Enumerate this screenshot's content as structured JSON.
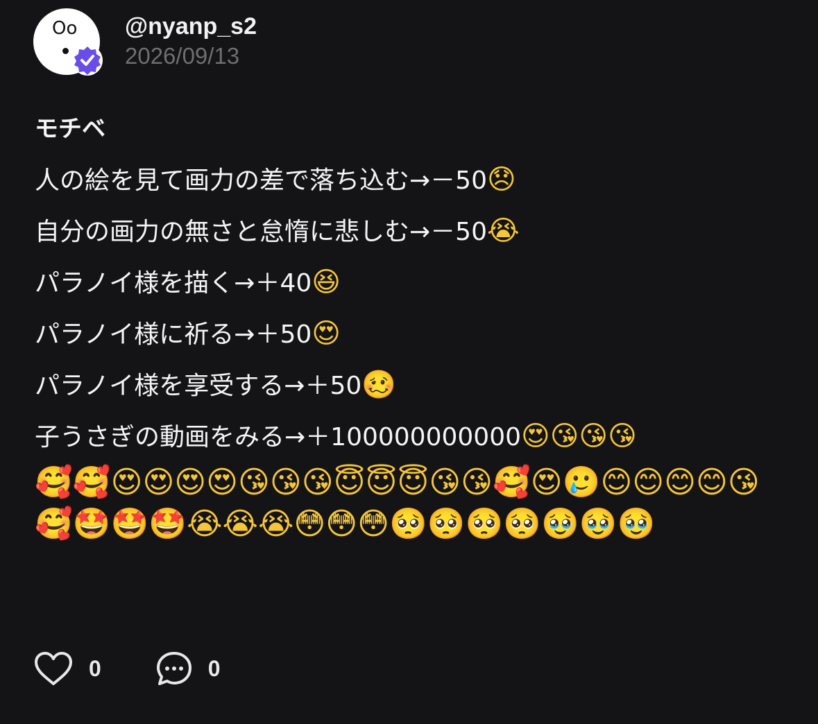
{
  "post": {
    "author": {
      "avatar_text": "Oo",
      "username": "@nyanp_s2",
      "verified": true
    },
    "date": "2026/09/13",
    "title": "モチベ",
    "lines": [
      {
        "text": "人の絵を見て画力の差で落ち込む→－50",
        "emoji": "😞"
      },
      {
        "text": "自分の画力の無さと怠惰に悲しむ→－50",
        "emoji": "😭"
      },
      {
        "text": "パラノイ様を描く→＋40",
        "emoji": "😆"
      },
      {
        "text": "パラノイ様に祈る→＋50",
        "emoji": "😍"
      },
      {
        "text": "パラノイ様を享受する→＋50",
        "emoji": "🥴"
      },
      {
        "text": "子うさぎの動画をみる→＋100000000000",
        "emoji": "😍😘😘😘"
      }
    ],
    "emoji_trail": "🥰🥰😍😍😍😍😘😘😘😇😇😇😘😘🥰😍🥲😊😊😊😊😘🥰🤩🤩🤩😭😭😭😳😳😳🥺🥺🥺🥺🥹🥹🥹",
    "actions": {
      "like_count": "0",
      "comment_count": "0"
    },
    "colors": {
      "background": "#141416",
      "text": "#f5f5f5",
      "date": "#6e6e73",
      "verified_badge": "#6a4de8"
    },
    "icons": {
      "like": "heart-outline-icon",
      "comment": "speech-bubble-icon",
      "verified": "verified-check-badge-icon"
    }
  }
}
